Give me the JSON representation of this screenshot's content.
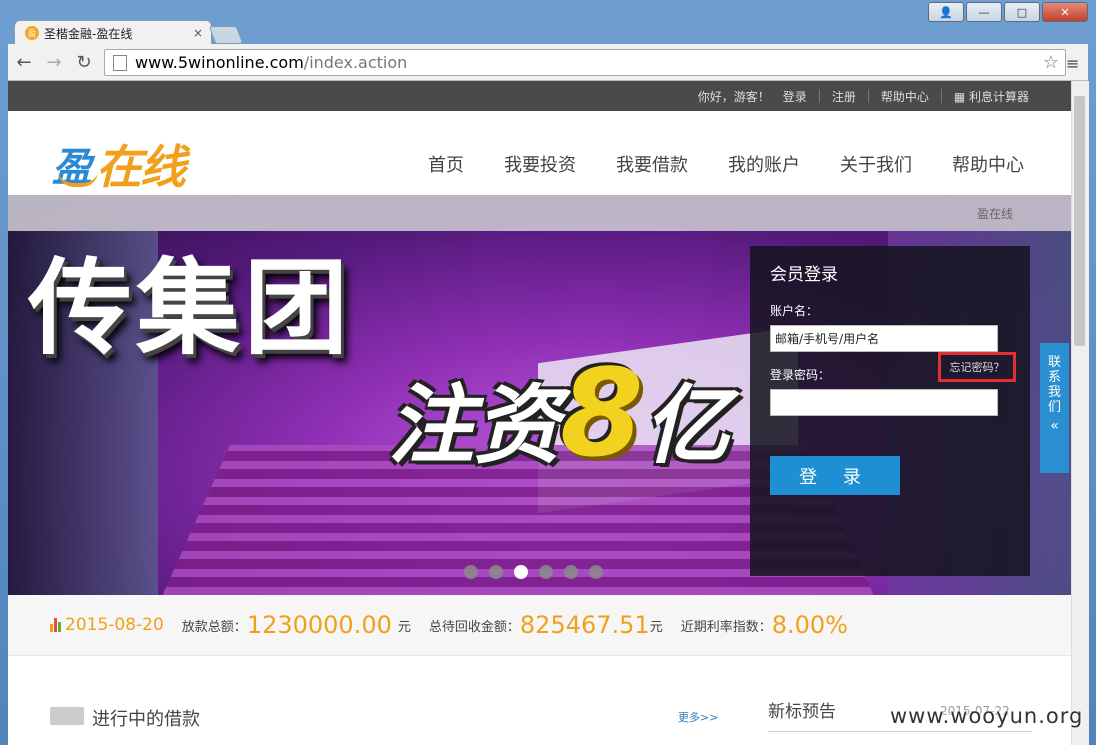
{
  "browser": {
    "tab_title": "圣楷金融-盈在线",
    "tab_close": "×",
    "favicon": "盈",
    "url_host": "www.5winonline.com",
    "url_path": "/index.action",
    "star": "☆",
    "menu": "≡",
    "back": "←",
    "forward": "→",
    "reload": "↻",
    "win_user": "👤",
    "win_min": "—",
    "win_max": "□",
    "win_close": "✕"
  },
  "topbar": {
    "greeting": "你好，游客！",
    "login": "登录",
    "register": "注册",
    "help": "帮助中心",
    "calculator": "▦ 利息计算器"
  },
  "logo": {
    "yi": "盈",
    "zx": "在线"
  },
  "nav": {
    "items": [
      "首页",
      "我要投资",
      "我要借款",
      "我的账户",
      "关于我们",
      "帮助中心"
    ]
  },
  "banner": {
    "breadcrumb": "盈在线",
    "headline_1": "传集团",
    "headline_2a": "注资",
    "headline_2b": "8",
    "headline_2c": "亿",
    "slides": 6,
    "active_slide": 3
  },
  "login": {
    "title": "会员登录",
    "username_label": "账户名：",
    "username_placeholder": "邮箱/手机号/用户名",
    "password_label": "登录密码：",
    "forgot": "忘记密码？",
    "submit": "登 录"
  },
  "contact": {
    "chars": [
      "联",
      "系",
      "我",
      "们"
    ],
    "arrow": "«"
  },
  "stats": {
    "date": "2015-08-20",
    "loan_label": "放款总额：",
    "loan_value": "1230000.00",
    "loan_unit": "元",
    "pending_label": "总待回收金额：",
    "pending_value": "825467.51",
    "pending_unit": "元",
    "rate_label": "近期利率指数：",
    "rate_value": "8.00%"
  },
  "sections": {
    "ongoing": "进行中的借款",
    "more": "更多>>",
    "new_bids": "新标预告",
    "date_partial": "2015-07-22"
  },
  "watermark": "www.wooyun.org",
  "colors": {
    "accent": "#f2a01c",
    "blue": "#1e8fd2",
    "highlight": "#e23030"
  }
}
